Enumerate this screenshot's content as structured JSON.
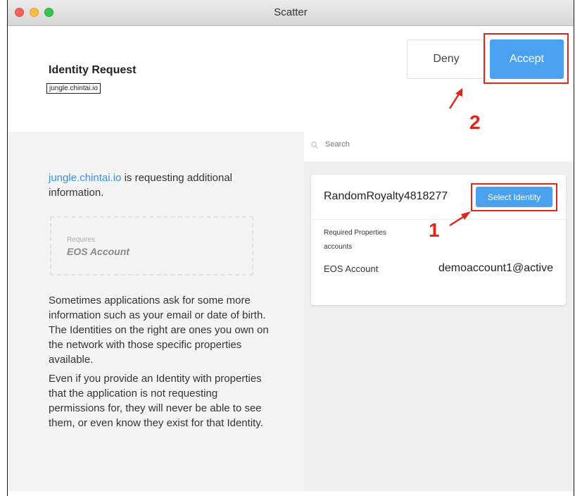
{
  "window": {
    "title": "Scatter"
  },
  "header": {
    "title": "Identity Request",
    "domain": "jungle.chintai.io",
    "deny_label": "Deny",
    "accept_label": "Accept"
  },
  "left": {
    "domain_link": "jungle.chintai.io",
    "request_suffix": " is requesting additional information.",
    "requires_label": "Requires",
    "requires_value": "EOS Account",
    "para1": "Sometimes applications ask for some more information such as your email or date of birth. The Identities on the right are ones you own on the network with those specific properties available.",
    "para2": "Even if you provide an Identity with properties that the application is not requesting permissions for, they will never be able to see them, or even know they exist for that Identity."
  },
  "search": {
    "placeholder": "Search"
  },
  "identity_card": {
    "name": "RandomRoyalty4818277",
    "select_label": "Select Identity",
    "required_properties_label": "Required Properties",
    "required_properties_value": "accounts",
    "account_label": "EOS Account",
    "account_value": "demoaccount1@active"
  },
  "annotations": {
    "marker_1": "1",
    "marker_2": "2"
  },
  "colors": {
    "accent": "#4aa1ef",
    "highlight": "#e0261b",
    "link": "#3d8fe5"
  }
}
